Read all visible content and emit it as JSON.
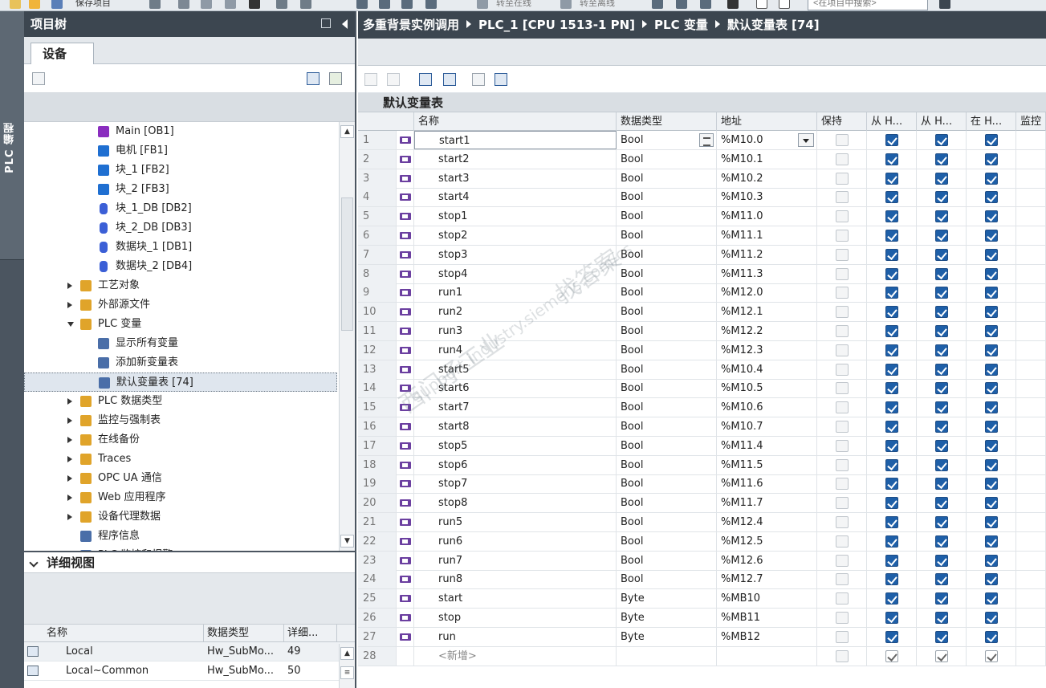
{
  "toolbar": {
    "save_project_label": "保存项目",
    "go_online_label": "转至在线",
    "go_offline_label": "转至离线",
    "search_placeholder": "<在项目中搜索>"
  },
  "side_strip": {
    "label": "PLC 编程"
  },
  "project_tree": {
    "title": "项目树",
    "tab_label": "设备",
    "items": [
      {
        "label": "Main [OB1]",
        "icon": "ob-block-icon",
        "color": "#8a2dbf",
        "expander": "none",
        "level": 3
      },
      {
        "label": "电机 [FB1]",
        "icon": "fb-block-icon",
        "color": "#1f6fd1",
        "expander": "none",
        "level": 3
      },
      {
        "label": "块_1 [FB2]",
        "icon": "fb-block-icon",
        "color": "#1f6fd1",
        "expander": "none",
        "level": 3
      },
      {
        "label": "块_2 [FB3]",
        "icon": "fb-block-icon",
        "color": "#1f6fd1",
        "expander": "none",
        "level": 3
      },
      {
        "label": "块_1_DB [DB2]",
        "icon": "db-block-icon",
        "color": "#3b5fd6",
        "expander": "none",
        "level": 3
      },
      {
        "label": "块_2_DB [DB3]",
        "icon": "db-block-icon",
        "color": "#3b5fd6",
        "expander": "none",
        "level": 3
      },
      {
        "label": "数据块_1 [DB1]",
        "icon": "db-block-icon",
        "color": "#3b5fd6",
        "expander": "none",
        "level": 3
      },
      {
        "label": "数据块_2 [DB4]",
        "icon": "db-block-icon",
        "color": "#3b5fd6",
        "expander": "none",
        "level": 3
      },
      {
        "label": "工艺对象",
        "icon": "technology-objects-icon",
        "color": "#e0a42a",
        "expander": "collapsed",
        "level": 2
      },
      {
        "label": "外部源文件",
        "icon": "external-sources-icon",
        "color": "#e0a42a",
        "expander": "collapsed",
        "level": 2
      },
      {
        "label": "PLC 变量",
        "icon": "plc-tags-folder-icon",
        "color": "#e0a42a",
        "expander": "expanded",
        "level": 2
      },
      {
        "label": "显示所有变量",
        "icon": "show-all-tags-icon",
        "color": "#4a6ea8",
        "expander": "none",
        "level": 3
      },
      {
        "label": "添加新变量表",
        "icon": "add-tag-table-icon",
        "color": "#4a6ea8",
        "expander": "none",
        "level": 3
      },
      {
        "label": "默认变量表 [74]",
        "icon": "tag-table-icon",
        "color": "#4a6ea8",
        "expander": "none",
        "level": 3,
        "selected": true
      },
      {
        "label": "PLC 数据类型",
        "icon": "plc-data-types-icon",
        "color": "#e0a42a",
        "expander": "collapsed",
        "level": 2
      },
      {
        "label": "监控与强制表",
        "icon": "watch-force-tables-icon",
        "color": "#e0a42a",
        "expander": "collapsed",
        "level": 2
      },
      {
        "label": "在线备份",
        "icon": "online-backups-icon",
        "color": "#e0a42a",
        "expander": "collapsed",
        "level": 2
      },
      {
        "label": "Traces",
        "icon": "traces-icon",
        "color": "#e0a42a",
        "expander": "collapsed",
        "level": 2
      },
      {
        "label": "OPC UA 通信",
        "icon": "opc-ua-icon",
        "color": "#e0a42a",
        "expander": "collapsed",
        "level": 2
      },
      {
        "label": "Web 应用程序",
        "icon": "web-apps-icon",
        "color": "#e0a42a",
        "expander": "collapsed",
        "level": 2
      },
      {
        "label": "设备代理数据",
        "icon": "device-proxy-icon",
        "color": "#e0a42a",
        "expander": "collapsed",
        "level": 2
      },
      {
        "label": "程序信息",
        "icon": "program-info-icon",
        "color": "#4a6ea8",
        "expander": "none",
        "level": 2
      },
      {
        "label": "PLC 监控和报警",
        "icon": "plc-alarms-icon",
        "color": "#4a6ea8",
        "expander": "none",
        "level": 2
      }
    ]
  },
  "detail_view": {
    "title": "详细视图",
    "columns": [
      "名称",
      "数据类型",
      "详细..."
    ],
    "rows": [
      {
        "name": "Local",
        "type": "Hw_SubMo...",
        "detail": "49"
      },
      {
        "name": "Local~Common",
        "type": "Hw_SubMo...",
        "detail": "50"
      }
    ]
  },
  "editor": {
    "breadcrumb": [
      "多重背景实例调用",
      "PLC_1 [CPU 1513-1 PN]",
      "PLC 变量",
      "默认变量表 [74]"
    ],
    "table_title": "默认变量表",
    "columns": [
      "",
      "名称",
      "数据类型",
      "地址",
      "保持",
      "从 H...",
      "从 H...",
      "在 H...",
      "监控"
    ],
    "add_new_label": "<新增>",
    "rows": [
      {
        "n": "1",
        "name": "start1",
        "type": "Bool",
        "addr": "%M10.0"
      },
      {
        "n": "2",
        "name": "start2",
        "type": "Bool",
        "addr": "%M10.1"
      },
      {
        "n": "3",
        "name": "start3",
        "type": "Bool",
        "addr": "%M10.2"
      },
      {
        "n": "4",
        "name": "start4",
        "type": "Bool",
        "addr": "%M10.3"
      },
      {
        "n": "5",
        "name": "stop1",
        "type": "Bool",
        "addr": "%M11.0"
      },
      {
        "n": "6",
        "name": "stop2",
        "type": "Bool",
        "addr": "%M11.1"
      },
      {
        "n": "7",
        "name": "stop3",
        "type": "Bool",
        "addr": "%M11.2"
      },
      {
        "n": "8",
        "name": "stop4",
        "type": "Bool",
        "addr": "%M11.3"
      },
      {
        "n": "9",
        "name": "run1",
        "type": "Bool",
        "addr": "%M12.0"
      },
      {
        "n": "10",
        "name": "run2",
        "type": "Bool",
        "addr": "%M12.1"
      },
      {
        "n": "11",
        "name": "run3",
        "type": "Bool",
        "addr": "%M12.2"
      },
      {
        "n": "12",
        "name": "run4",
        "type": "Bool",
        "addr": "%M12.3"
      },
      {
        "n": "13",
        "name": "start5",
        "type": "Bool",
        "addr": "%M10.4"
      },
      {
        "n": "14",
        "name": "start6",
        "type": "Bool",
        "addr": "%M10.5"
      },
      {
        "n": "15",
        "name": "start7",
        "type": "Bool",
        "addr": "%M10.6"
      },
      {
        "n": "16",
        "name": "start8",
        "type": "Bool",
        "addr": "%M10.7"
      },
      {
        "n": "17",
        "name": "stop5",
        "type": "Bool",
        "addr": "%M11.4"
      },
      {
        "n": "18",
        "name": "stop6",
        "type": "Bool",
        "addr": "%M11.5"
      },
      {
        "n": "19",
        "name": "stop7",
        "type": "Bool",
        "addr": "%M11.6"
      },
      {
        "n": "20",
        "name": "stop8",
        "type": "Bool",
        "addr": "%M11.7"
      },
      {
        "n": "21",
        "name": "run5",
        "type": "Bool",
        "addr": "%M12.4"
      },
      {
        "n": "22",
        "name": "run6",
        "type": "Bool",
        "addr": "%M12.5"
      },
      {
        "n": "23",
        "name": "run7",
        "type": "Bool",
        "addr": "%M12.6"
      },
      {
        "n": "24",
        "name": "run8",
        "type": "Bool",
        "addr": "%M12.7"
      },
      {
        "n": "25",
        "name": "start",
        "type": "Byte",
        "addr": "%MB10"
      },
      {
        "n": "26",
        "name": "stop",
        "type": "Byte",
        "addr": "%MB11"
      },
      {
        "n": "27",
        "name": "run",
        "type": "Byte",
        "addr": "%MB12"
      }
    ],
    "new_row_number": "28"
  },
  "watermark": {
    "line1": "西门子工业",
    "line2": "support.industry.siemens.com/cs",
    "line3": "找答案"
  },
  "colors": {
    "header_bg": "#3c4650",
    "checkbox_on": "#1e5fa8",
    "tag_icon": "#6b3fa0",
    "selection": "#dfe6ee"
  }
}
